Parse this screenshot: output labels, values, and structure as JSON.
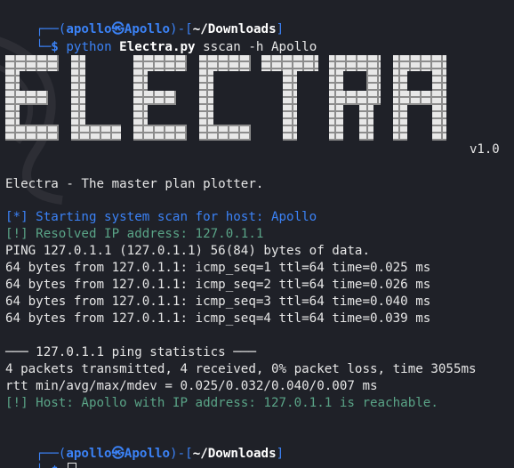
{
  "prompt": {
    "tl": "┌──",
    "bl": "└─",
    "paren_open": "(",
    "user": "apollo",
    "at": "㉿",
    "host": "Apollo",
    "paren_close": ")",
    "dash": "-",
    "bracket_open": "[",
    "path": "~/Downloads",
    "bracket_close": "]",
    "dollar": "$"
  },
  "command": {
    "bin": "python",
    "script": "Electra.py",
    "args": "sscan -h Apollo"
  },
  "banner": {
    "text": "ELECTRA",
    "version": "v1.0"
  },
  "output": {
    "tagline": "Electra - The master plan plotter.",
    "scan_start": "[*] Starting system scan for host: Apollo",
    "resolved": "[!] Resolved IP address: 127.0.1.1",
    "ping_header": "PING 127.0.1.1 (127.0.1.1) 56(84) bytes of data.",
    "ping_lines": [
      "64 bytes from 127.0.1.1: icmp_seq=1 ttl=64 time=0.025 ms",
      "64 bytes from 127.0.1.1: icmp_seq=2 ttl=64 time=0.026 ms",
      "64 bytes from 127.0.1.1: icmp_seq=3 ttl=64 time=0.040 ms",
      "64 bytes from 127.0.1.1: icmp_seq=4 ttl=64 time=0.039 ms"
    ],
    "stats_header": "─── 127.0.1.1 ping statistics ───",
    "stats_packets": "4 packets transmitted, 4 received, 0% packet loss, time 3055ms",
    "stats_rtt": "rtt min/avg/max/mdev = 0.025/0.032/0.040/0.007 ms",
    "reachable": "[!] Host: Apollo with IP address: 127.0.1.1 is reachable."
  },
  "colors": {
    "background": "#1f2128",
    "prompt_blue": "#3b82f6",
    "info_green": "#5aa487",
    "text": "#e6e6e6"
  }
}
